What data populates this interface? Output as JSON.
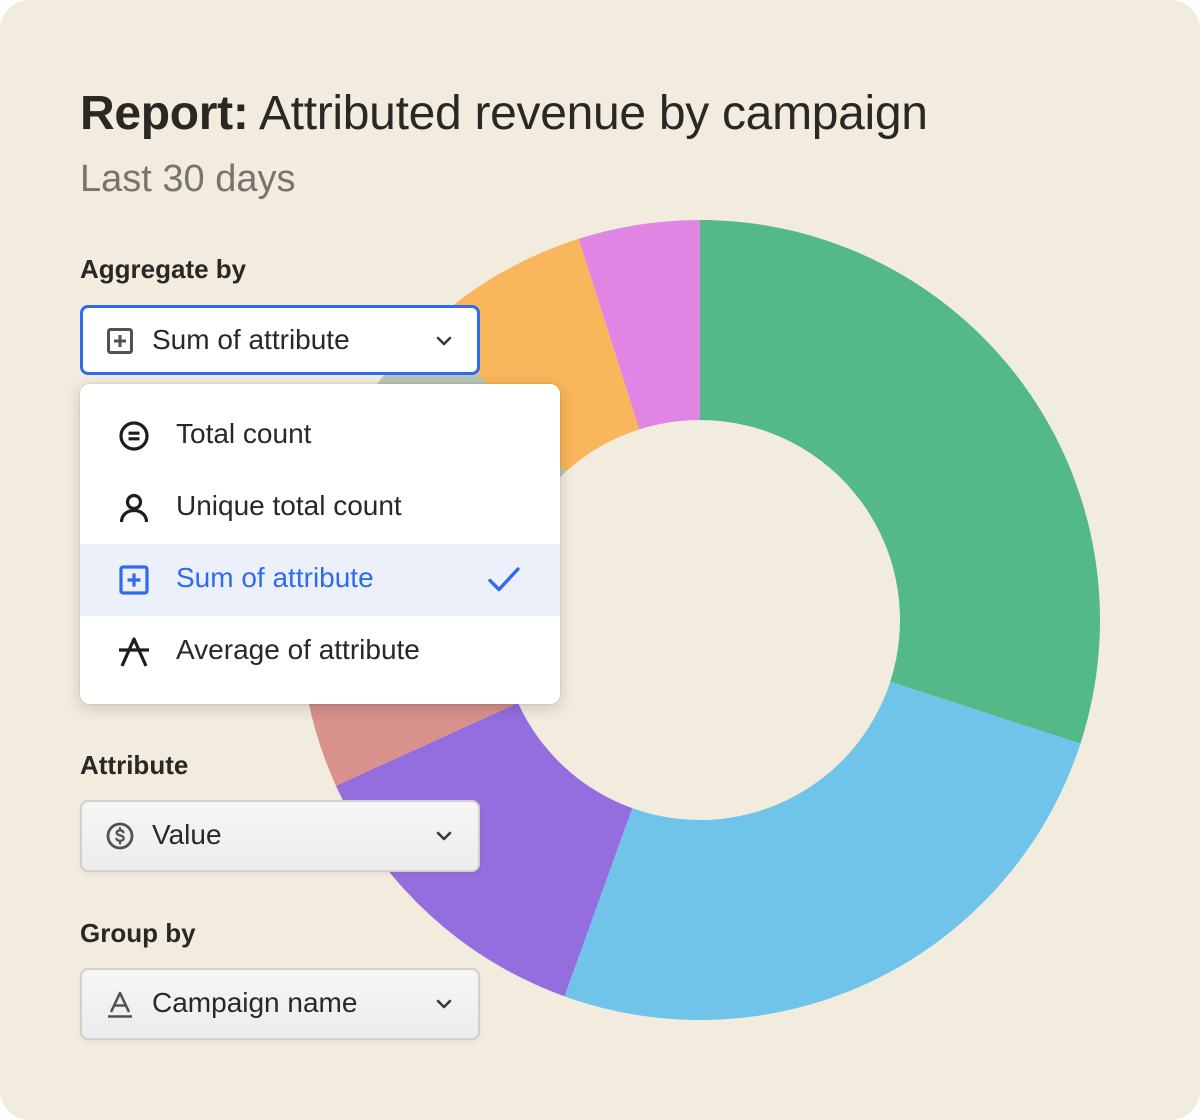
{
  "report": {
    "title_prefix": "Report:",
    "title_rest": " Attributed revenue by campaign",
    "subtitle": "Last 30 days"
  },
  "aggregate": {
    "label": "Aggregate by",
    "selected": "Sum of attribute",
    "selected_icon": "plus-square-icon",
    "options": [
      {
        "label": "Total count",
        "icon": "equals-circle-icon"
      },
      {
        "label": "Unique total count",
        "icon": "person-icon"
      },
      {
        "label": "Sum of attribute",
        "icon": "plus-square-icon",
        "selected": true
      },
      {
        "label": "Average of attribute",
        "icon": "average-icon"
      }
    ]
  },
  "attribute": {
    "label": "Attribute",
    "value": "Value",
    "icon": "dollar-circle-icon"
  },
  "group_by": {
    "label": "Group by",
    "value": "Campaign name",
    "icon": "text-a-icon"
  },
  "colors": {
    "background": "#f2ecdf",
    "accent": "#2f6bef",
    "selected_row": "#ebf0fb"
  },
  "chart_data": {
    "type": "pie",
    "hole": "donut",
    "slices": [
      {
        "value": 30.0,
        "color": "#52b987"
      },
      {
        "value": 25.5,
        "color": "#70c4e9"
      },
      {
        "value": 12.7,
        "color": "#946ddf"
      },
      {
        "value": 3.6,
        "color": "#d9918b"
      },
      {
        "value": 16.5,
        "color": "#b9c7b5"
      },
      {
        "value": 6.8,
        "color": "#f9b65a"
      },
      {
        "value": 4.9,
        "color": "#e185e5"
      }
    ]
  }
}
